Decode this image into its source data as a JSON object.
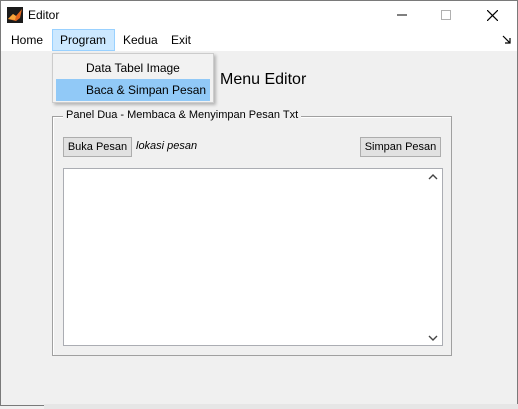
{
  "window": {
    "title": "Editor"
  },
  "menubar": {
    "items": [
      {
        "label": "Home"
      },
      {
        "label": "Program"
      },
      {
        "label": "Kedua"
      },
      {
        "label": "Exit"
      }
    ]
  },
  "dropdown": {
    "items": [
      {
        "label": "Data Tabel Image"
      },
      {
        "label": "Baca & Simpan Pesan"
      }
    ]
  },
  "main": {
    "heading": "Menu Editor",
    "panel": {
      "title": "Panel Dua - Membaca & Menyimpan Pesan Txt",
      "open_button": "Buka Pesan",
      "location_text": "lokasi pesan",
      "save_button": "Simpan Pesan"
    }
  },
  "colors": {
    "menu_highlight": "#cce8ff",
    "dropdown_highlight": "#91c9f7"
  }
}
